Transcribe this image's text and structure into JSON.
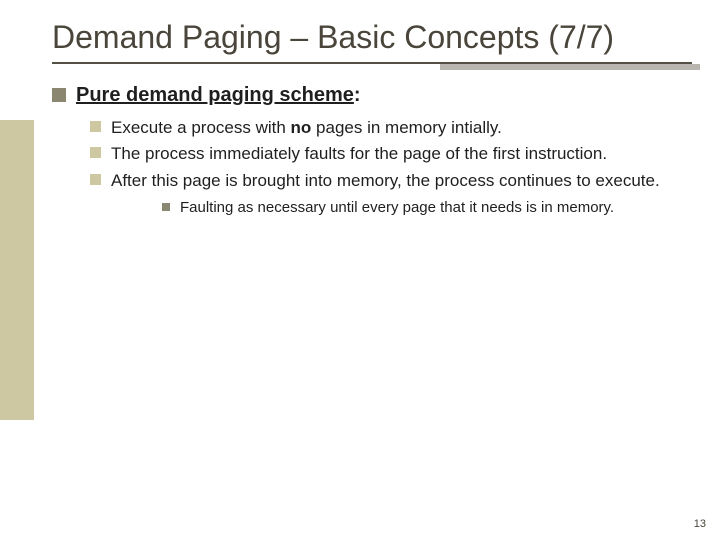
{
  "title": "Demand Paging – Basic Concepts (7/7)",
  "main": {
    "heading_prefix": "Pure demand paging scheme",
    "heading_suffix": ":",
    "items": [
      {
        "pre": "Execute a process with ",
        "bold": "no",
        "post": " pages in memory intially."
      },
      {
        "pre": "The process immediately faults for the page of the first instruction.",
        "bold": "",
        "post": ""
      },
      {
        "pre": "After this page is brought into memory, the process continues to execute.",
        "bold": "",
        "post": ""
      }
    ],
    "sub": "Faulting as necessary until every page that it needs is in memory."
  },
  "page_number": "13"
}
